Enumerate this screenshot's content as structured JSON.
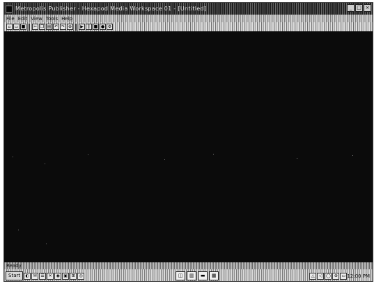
{
  "window": {
    "title": "Metropolis Publisher - Hexapod Media Workspace 01 - [Untitled]",
    "controls": [
      "_",
      "□",
      "×"
    ]
  },
  "menubar": {
    "items": [
      "File",
      "Edit",
      "View",
      "Tools",
      "Help"
    ]
  },
  "toolbar": {
    "buttons": [
      {
        "icon": "new-icon",
        "glyph": "▫"
      },
      {
        "icon": "open-icon",
        "glyph": "▭"
      },
      {
        "icon": "save-icon",
        "glyph": "■"
      },
      {
        "icon": "cut-icon",
        "glyph": "✂"
      },
      {
        "icon": "copy-icon",
        "glyph": "❐"
      },
      {
        "icon": "paste-icon",
        "glyph": "▤"
      },
      {
        "icon": "undo-icon",
        "glyph": "↶"
      },
      {
        "icon": "redo-icon",
        "glyph": "↷"
      },
      {
        "icon": "zoom-icon",
        "glyph": "⊕"
      },
      {
        "icon": "play-icon",
        "glyph": "▶"
      },
      {
        "icon": "pause-icon",
        "glyph": "‖"
      },
      {
        "icon": "stop-icon",
        "glyph": "■"
      },
      {
        "icon": "record-icon",
        "glyph": "●"
      },
      {
        "icon": "settings-icon",
        "glyph": "⚙"
      }
    ]
  },
  "statusbar": {
    "text": "Ready"
  },
  "taskbar": {
    "start_label": "Start",
    "quick_launch": [
      "◐",
      "✉",
      "☰",
      "✕",
      "◉",
      "▣",
      "⊞",
      "◎"
    ],
    "task_buttons": [
      "◫",
      "▥",
      "▬",
      "▦"
    ],
    "tray": [
      "△",
      "◁",
      "◯",
      "⊕",
      "▭"
    ],
    "clock": "12:00 PM"
  }
}
